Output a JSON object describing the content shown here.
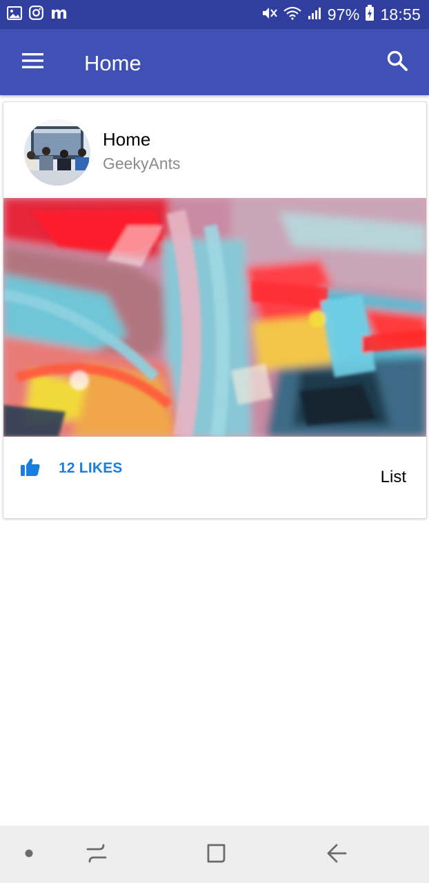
{
  "status_bar": {
    "battery": "97%",
    "time": "18:55",
    "left_icons": [
      "gallery-icon",
      "instagram-icon",
      "messenger-m-icon"
    ],
    "right_icons": [
      "mute-icon",
      "wifi-icon",
      "signal-icon",
      "battery-charging-icon"
    ],
    "messenger_glyph": "m"
  },
  "app_bar": {
    "title": "Home",
    "menu_icon": "hamburger-menu-icon",
    "search_icon": "search-icon"
  },
  "card": {
    "title": "Home",
    "subtitle": "GeekyAnts",
    "likes_label": "12 LIKES",
    "list_label": "List"
  },
  "nav_bar": {
    "items": [
      "recent-dot-icon",
      "recent-apps-icon",
      "home-square-icon",
      "back-arrow-icon"
    ]
  },
  "colors": {
    "status_bar": "#303f9f",
    "app_bar": "#3f51b5",
    "accent_blue": "#1a7ee0",
    "subtitle_gray": "#8a8a8a",
    "nav_bar": "#eeeeee"
  }
}
